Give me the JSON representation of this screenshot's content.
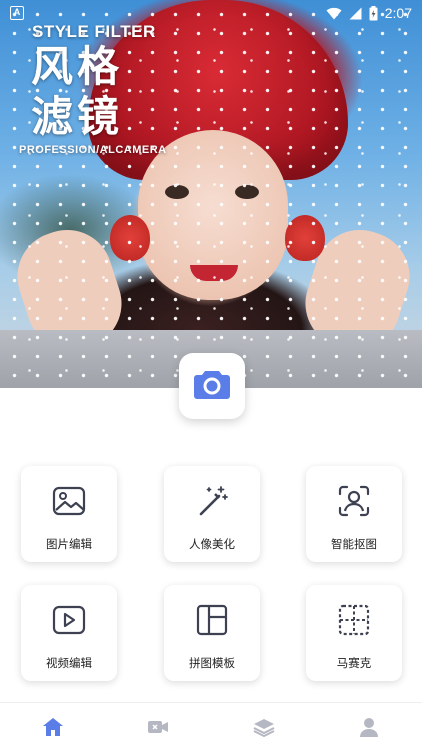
{
  "status_bar": {
    "time": "2:07",
    "notification_badge": "A"
  },
  "hero": {
    "style_filter": "STYLE FILTER",
    "title_line1": "风格",
    "title_line2": "滤镜",
    "subtitle": "PROFESSION/ALCAMERA"
  },
  "camera": {
    "icon": "camera-icon",
    "accent": "#5b7de8"
  },
  "tools": [
    {
      "label": "图片编辑",
      "icon": "image-edit-icon"
    },
    {
      "label": "人像美化",
      "icon": "magic-wand-icon"
    },
    {
      "label": "智能抠图",
      "icon": "portrait-cutout-icon"
    },
    {
      "label": "视频编辑",
      "icon": "video-play-icon"
    },
    {
      "label": "拼图模板",
      "icon": "collage-layout-icon"
    },
    {
      "label": "马赛克",
      "icon": "mosaic-icon"
    }
  ],
  "bottom_nav": [
    {
      "name": "home",
      "icon": "home-icon",
      "active": true
    },
    {
      "name": "video",
      "icon": "video-camera-icon",
      "active": false
    },
    {
      "name": "layers",
      "icon": "layers-icon",
      "active": false
    },
    {
      "name": "profile",
      "icon": "person-icon",
      "active": false
    }
  ],
  "colors": {
    "accent": "#5b7de8",
    "icon_gray": "#3d4152",
    "nav_gray": "#b5b8c2"
  }
}
